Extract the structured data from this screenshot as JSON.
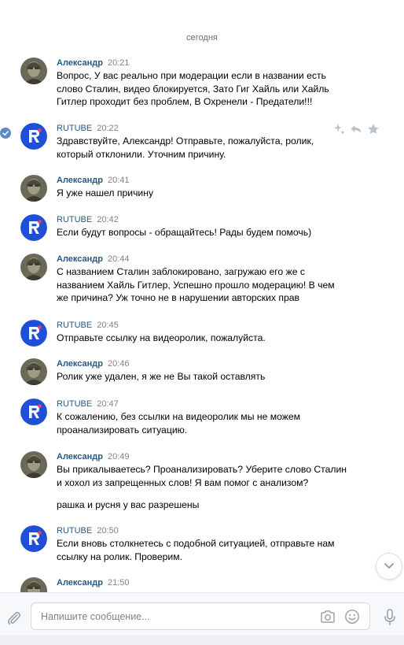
{
  "date_separator": "сегодня",
  "messages": [
    {
      "author": "Александр",
      "time": "20:21",
      "type": "user",
      "paragraphs": [
        "Вопрос, У вас реально при модерации если в названии есть слово Сталин, видео блокируется, Зато Гиг Хайль или Хайль Гитлер проходит без проблем, В Охренели - Предатели!!!"
      ]
    },
    {
      "author": "RUTUBE",
      "time": "20:22",
      "type": "rutube",
      "paragraphs": [
        "Здравствуйте, Александр! Отправьте, пожалуйста, ролик, который отклонили. Уточним причину."
      ]
    },
    {
      "author": "Александр",
      "time": "20:41",
      "type": "user",
      "paragraphs": [
        "Я уже нашел причину"
      ]
    },
    {
      "author": "RUTUBE",
      "time": "20:42",
      "type": "rutube",
      "paragraphs": [
        "Если будут вопросы - обращайтесь! Рады будем помочь)"
      ]
    },
    {
      "author": "Александр",
      "time": "20:44",
      "type": "user",
      "paragraphs": [
        "С названием Сталин заблокировано, загружаю его же с названием Хайль Гитлер, Успешно прошло модерацию! В чем же причина? Уж точно не в нарушении авторских прав"
      ]
    },
    {
      "author": "RUTUBE",
      "time": "20:45",
      "type": "rutube",
      "paragraphs": [
        "Отправьте ссылку на видеоролик, пожалуйста."
      ]
    },
    {
      "author": "Александр",
      "time": "20:46",
      "type": "user",
      "paragraphs": [
        "Ролик уже удален, я же не Вы такой оставлять"
      ]
    },
    {
      "author": "RUTUBE",
      "time": "20:47",
      "type": "rutube",
      "paragraphs": [
        "К сожалению, без ссылки на видеоролик мы не можем проанализировать ситуацию."
      ]
    },
    {
      "author": "Александр",
      "time": "20:49",
      "type": "user",
      "paragraphs": [
        "Вы прикалываетесь? Проанализировать? Уберите слово Сталин и хохол из запрещенных слов! Я вам помог с анализом?",
        "рашка и русня у вас разрешены"
      ]
    },
    {
      "author": "RUTUBE",
      "time": "20:50",
      "type": "rutube",
      "paragraphs": [
        "Если вновь столкнетесь с подобной ситуацией, отправьте нам ссылку на ролик. Проверим."
      ]
    },
    {
      "author": "Александр",
      "time": "21:50",
      "type": "user",
      "paragraphs": []
    }
  ],
  "composer": {
    "placeholder": "Напишите сообщение..."
  },
  "icons": {
    "attach": "paperclip-icon",
    "camera": "camera-icon",
    "emoji": "emoji-icon",
    "mic": "microphone-icon",
    "scroll_down": "chevron-down-icon",
    "read_check": "checkmark-icon",
    "sparkle": "sparkle-icon",
    "reply": "reply-icon",
    "favorite": "star-icon"
  },
  "colors": {
    "author": "#2a5885",
    "time": "#828282",
    "rutube_brand": "#1f4fd8",
    "composer_bg": "#f7f8fa"
  }
}
